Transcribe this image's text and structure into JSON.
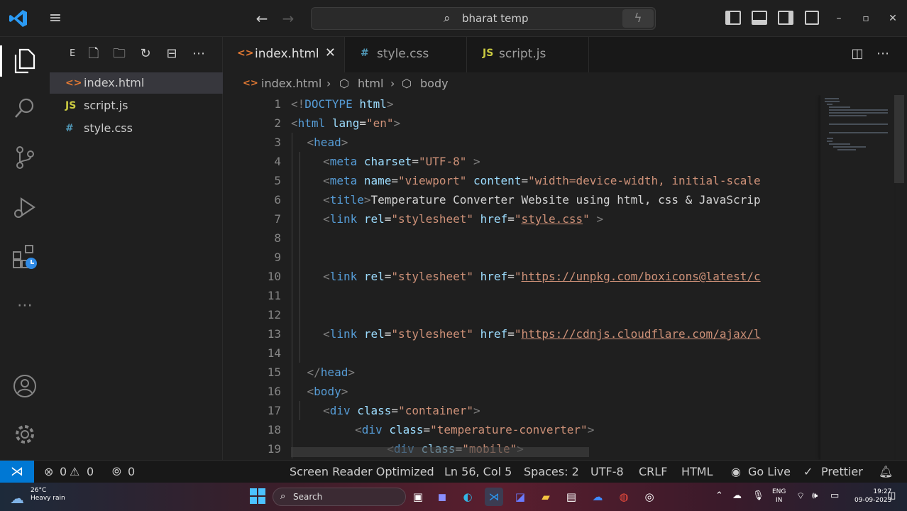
{
  "title_bar": {
    "search_query": "bharat temp",
    "window_controls": {
      "minimize": "–",
      "maximize": "▫",
      "close": "✕"
    }
  },
  "sidebar": {
    "title": "E",
    "files": [
      {
        "icon": "<>",
        "name": "index.html",
        "selected": true
      },
      {
        "icon": "JS",
        "name": "script.js"
      },
      {
        "icon": "#",
        "name": "style.css"
      }
    ]
  },
  "tabs": [
    {
      "icon": "<>",
      "label": "index.html",
      "active": true
    },
    {
      "icon": "#",
      "label": "style.css"
    },
    {
      "icon": "JS",
      "label": "script.js"
    }
  ],
  "breadcrumb": [
    "index.html",
    "html",
    "body"
  ],
  "editor": {
    "line_numbers": [
      "1",
      "2",
      "3",
      "4",
      "5",
      "6",
      "7",
      "8",
      "9",
      "10",
      "11",
      "12",
      "13",
      "14",
      "15",
      "16",
      "17",
      "18",
      "19"
    ],
    "lines": [
      {
        "indent": 0,
        "tokens": [
          [
            "k",
            "<!"
          ],
          [
            "t",
            "DOCTYPE"
          ],
          [
            "p",
            " "
          ],
          [
            "a",
            "html"
          ],
          [
            "k",
            ">"
          ]
        ]
      },
      {
        "indent": 0,
        "tokens": [
          [
            "k",
            "<"
          ],
          [
            "t",
            "html"
          ],
          [
            "p",
            " "
          ],
          [
            "a",
            "lang"
          ],
          [
            "p",
            "="
          ],
          [
            "s",
            "\"en\""
          ],
          [
            "k",
            ">"
          ]
        ]
      },
      {
        "indent": 1,
        "tokens": [
          [
            "k",
            "<"
          ],
          [
            "t",
            "head"
          ],
          [
            "k",
            ">"
          ]
        ]
      },
      {
        "indent": 2,
        "tokens": [
          [
            "k",
            "<"
          ],
          [
            "t",
            "meta"
          ],
          [
            "p",
            " "
          ],
          [
            "a",
            "charset"
          ],
          [
            "p",
            "="
          ],
          [
            "s",
            "\"UTF-8\""
          ],
          [
            "p",
            " "
          ],
          [
            "k",
            ">"
          ]
        ]
      },
      {
        "indent": 2,
        "tokens": [
          [
            "k",
            "<"
          ],
          [
            "t",
            "meta"
          ],
          [
            "p",
            " "
          ],
          [
            "a",
            "name"
          ],
          [
            "p",
            "="
          ],
          [
            "s",
            "\"viewport\""
          ],
          [
            "p",
            " "
          ],
          [
            "a",
            "content"
          ],
          [
            "p",
            "="
          ],
          [
            "s",
            "\"width=device-width, initial-scale"
          ]
        ]
      },
      {
        "indent": 2,
        "tokens": [
          [
            "k",
            "<"
          ],
          [
            "t",
            "title"
          ],
          [
            "k",
            ">"
          ],
          [
            "p",
            "Temperature Converter Website using html, css & JavaScrip"
          ]
        ]
      },
      {
        "indent": 2,
        "tokens": [
          [
            "k",
            "<"
          ],
          [
            "t",
            "link"
          ],
          [
            "p",
            " "
          ],
          [
            "a",
            "rel"
          ],
          [
            "p",
            "="
          ],
          [
            "s",
            "\"stylesheet\""
          ],
          [
            "p",
            " "
          ],
          [
            "a",
            "href"
          ],
          [
            "p",
            "="
          ],
          [
            "s",
            "\""
          ],
          [
            "u",
            "style.css"
          ],
          [
            "s",
            "\""
          ],
          [
            "p",
            " "
          ],
          [
            "k",
            ">"
          ]
        ]
      },
      {
        "indent": 2,
        "tokens": []
      },
      {
        "indent": 2,
        "tokens": []
      },
      {
        "indent": 2,
        "tokens": [
          [
            "k",
            "<"
          ],
          [
            "t",
            "link"
          ],
          [
            "p",
            " "
          ],
          [
            "a",
            "rel"
          ],
          [
            "p",
            "="
          ],
          [
            "s",
            "\"stylesheet\""
          ],
          [
            "p",
            " "
          ],
          [
            "a",
            "href"
          ],
          [
            "p",
            "="
          ],
          [
            "s",
            "\""
          ],
          [
            "u",
            "https://unpkg.com/boxicons@latest/c"
          ]
        ]
      },
      {
        "indent": 2,
        "tokens": []
      },
      {
        "indent": 2,
        "tokens": []
      },
      {
        "indent": 2,
        "tokens": [
          [
            "k",
            "<"
          ],
          [
            "t",
            "link"
          ],
          [
            "p",
            " "
          ],
          [
            "a",
            "rel"
          ],
          [
            "p",
            "="
          ],
          [
            "s",
            "\"stylesheet\""
          ],
          [
            "p",
            " "
          ],
          [
            "a",
            "href"
          ],
          [
            "p",
            "="
          ],
          [
            "s",
            "\""
          ],
          [
            "u",
            "https://cdnjs.cloudflare.com/ajax/l"
          ]
        ]
      },
      {
        "indent": 2,
        "tokens": []
      },
      {
        "indent": 1,
        "tokens": [
          [
            "k",
            "</"
          ],
          [
            "t",
            "head"
          ],
          [
            "k",
            ">"
          ]
        ]
      },
      {
        "indent": 1,
        "tokens": [
          [
            "k",
            "<"
          ],
          [
            "t",
            "body"
          ],
          [
            "k",
            ">"
          ]
        ]
      },
      {
        "indent": 2,
        "tokens": [
          [
            "k",
            "<"
          ],
          [
            "t",
            "div"
          ],
          [
            "p",
            " "
          ],
          [
            "a",
            "class"
          ],
          [
            "p",
            "="
          ],
          [
            "s",
            "\"container\""
          ],
          [
            "k",
            ">"
          ]
        ]
      },
      {
        "indent": 4,
        "tokens": [
          [
            "k",
            "<"
          ],
          [
            "t",
            "div"
          ],
          [
            "p",
            " "
          ],
          [
            "a",
            "class"
          ],
          [
            "p",
            "="
          ],
          [
            "s",
            "\"temperature-converter\""
          ],
          [
            "k",
            ">"
          ]
        ]
      },
      {
        "indent": 6,
        "tokens": [
          [
            "k",
            "<"
          ],
          [
            "t",
            "div"
          ],
          [
            "p",
            " "
          ],
          [
            "a",
            "class"
          ],
          [
            "p",
            "="
          ],
          [
            "s",
            "\"mobile\""
          ],
          [
            "k",
            ">"
          ]
        ]
      }
    ]
  },
  "status_bar": {
    "errors": "0",
    "warnings": "0",
    "ports": "0",
    "screen_reader": "Screen Reader Optimized",
    "cursor": "Ln 56, Col 5",
    "spaces": "Spaces: 2",
    "encoding": "UTF-8",
    "eol": "CRLF",
    "language": "HTML",
    "go_live": "Go Live",
    "prettier": "Prettier"
  },
  "taskbar": {
    "weather_temp": "26°C",
    "weather_desc": "Heavy rain",
    "search_placeholder": "Search",
    "lang_line1": "ENG",
    "lang_line2": "IN",
    "time": "19:27",
    "date": "09-09-2023"
  },
  "colors": {
    "accent": "#0078d4",
    "html_icon": "#e37933",
    "js_icon": "#cbcb41",
    "css_icon": "#519aba"
  }
}
